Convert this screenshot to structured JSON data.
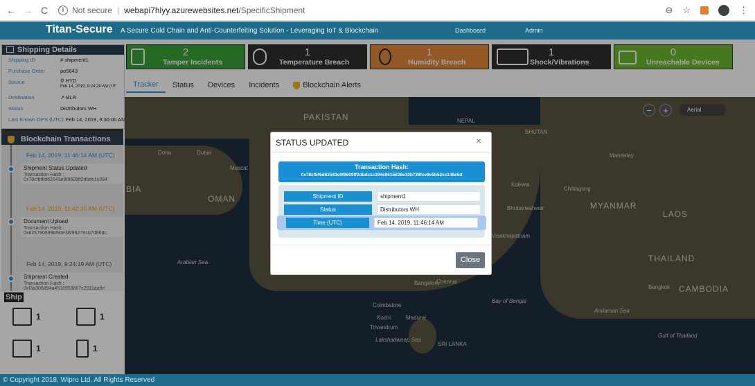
{
  "browser": {
    "security": "Not secure",
    "host": "webapi7hlyy.azurewebsites.net",
    "path": "/SpecificShipment"
  },
  "header": {
    "brand": "Titan-Secure",
    "tagline": "A Secure Cold Chain and Anti-Counterfeiting Solution - Leveraging IoT & Blockchain",
    "nav": [
      "Dashboard",
      "Admin"
    ]
  },
  "shipping_details": {
    "title": "Shipping Details",
    "rows": [
      {
        "k": "Shipping ID",
        "v": "# shipment1"
      },
      {
        "k": "Purchase Order",
        "v": "po5643"
      },
      {
        "k": "Source",
        "v": "HYD",
        "sub": "Feb 14, 2019, 9:24:28 AM (UT"
      },
      {
        "k": "Destination",
        "v": "BLR"
      },
      {
        "k": "Status",
        "v": "Distributors WH"
      },
      {
        "k": "Last Known GPS (UTC)",
        "v": "Feb 14, 2019, 9:30:00 AM"
      }
    ]
  },
  "blockchain": {
    "title": "Blockchain Transactions",
    "items": [
      {
        "date": "Feb 14, 2019, 11:46:14 AM (UTC)",
        "title": "Shipment Status Updated",
        "hash_label": "Transaction Hash :",
        "hash": "0x78cfbf6d62543e9f9609ff2dbdc1c394"
      },
      {
        "date": "Feb 14, 2019, 11:42:35 AM (UTC)",
        "title": "Document Upload",
        "hash_label": "Transaction Hash :",
        "hash": "0x826790899bf9de36f962791b7d86dc"
      },
      {
        "date": "Feb 14, 2019, 9:24:19 AM (UTC)",
        "title": "Shipment Created",
        "hash_label": "Transaction Hash :",
        "hash": "0xf3a306d94a4518953807c2511aa9e"
      }
    ]
  },
  "shipments": {
    "label": "Ship",
    "counts": [
      "1",
      "1",
      "1",
      "1"
    ]
  },
  "tiles": [
    {
      "num": "2",
      "label": "Tamper Incidents",
      "color": "#3aa238",
      "icon": "tamper-icon"
    },
    {
      "num": "1",
      "label": "Temperature Breach",
      "color": "#2f2f2f",
      "icon": "thermometer-icon"
    },
    {
      "num": "1",
      "label": "Humidity Breach",
      "color": "#e0883a",
      "icon": "humidity-icon"
    },
    {
      "num": "1",
      "label": "Shock/Vibrations",
      "color": "#2f2f2f",
      "icon": "box-shock-icon"
    },
    {
      "num": "0",
      "label": "Unreachable Devices",
      "color": "#6fb82e",
      "icon": "router-icon"
    }
  ],
  "tabs": [
    "Tracker",
    "Status",
    "Devices",
    "Incidents",
    "Blockchain Alerts"
  ],
  "map": {
    "aerial": "Aerial",
    "labels": [
      "PAKISTAN",
      "NEPAL",
      "BHUTAN",
      "OMAN",
      "MYANMAR",
      "LAOS",
      "THAILAND",
      "CAMBODIA",
      "SRI LANKA",
      "BIA",
      "Arabian Sea",
      "Bay of Bengal",
      "Andaman Sea",
      "Gulf of Thailand",
      "Muscat",
      "Dubai",
      "Doha",
      "Chittagong",
      "Kolkata",
      "Bhubaneshwar",
      "Chennai",
      "Bangalore",
      "Kochi",
      "Madurai",
      "Coimbatore",
      "Trivandrum",
      "Lakshadweep Sea",
      "Visakhapatnam",
      "Bangkok",
      "Mandalay"
    ]
  },
  "modal": {
    "title": "STATUS UPDATED",
    "close_x": "×",
    "hash_title": "Transaction Hash:",
    "hash": "0x78cfbf6d62543e9f9609ff2dbdc1c394e8615628e10b738fce9e5b52ec148e5d",
    "fields": [
      {
        "k": "Shipment ID",
        "v": "shipment1"
      },
      {
        "k": "Status",
        "v": "Distributors WH"
      },
      {
        "k": "Time (UTC)",
        "v": "Feb 14, 2019, 11:46:14 AM"
      }
    ],
    "close_label": "Close"
  },
  "footer": "© Copyright 2018, Wipro Ltd. All Rights Reserved"
}
